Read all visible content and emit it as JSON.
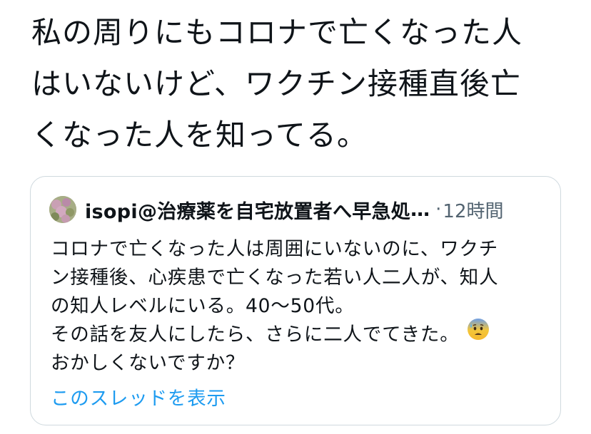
{
  "tweet": {
    "text_lines": [
      "私の周りにもコロナで亡くなった人",
      "はいないけど、ワクチン接種直後亡",
      "くなった人を知ってる。"
    ]
  },
  "quoted_tweet": {
    "author": "isopi@治療薬を自宅放置者へ早急処",
    "ellipsis": "…",
    "dot": "·",
    "time": "12時間",
    "text_lines": [
      "コロナで亡くなった人は周囲にいないのに、ワクチ",
      "ン接種後、心疾患で亡くなった若い人二人が、知人",
      "の知人レベルにいる。40〜50代。",
      "その話を友人にしたら、さらに二人でてきた。",
      "おかしくないですか？"
    ],
    "emoji_icon": "anxious-face-with-sweat-icon",
    "show_thread_label": "このスレッドを表示"
  },
  "colors": {
    "text": "#0f1419",
    "secondary": "#536471",
    "link": "#1d9bf0",
    "border": "#cfd9de"
  }
}
